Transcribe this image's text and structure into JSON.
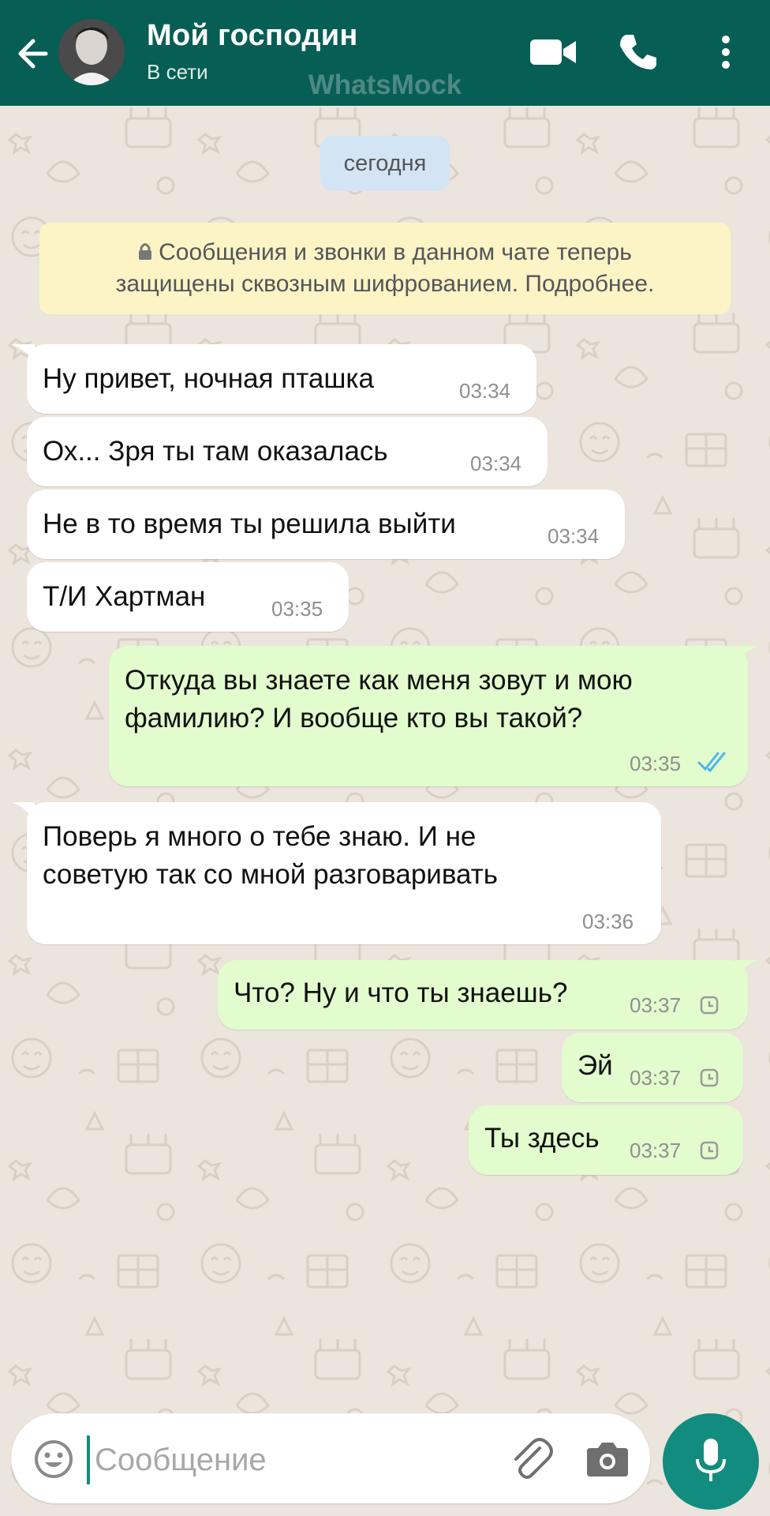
{
  "header": {
    "contact_name": "Мой господин",
    "status": "В сети",
    "watermark": "WhatsMock",
    "icons": [
      "back-arrow-icon",
      "avatar",
      "video-camera-icon",
      "phone-icon",
      "more-vertical-icon"
    ]
  },
  "chat": {
    "date_label": "сегодня",
    "encryption_notice_line1": "Сообщения и звонки в данном чате теперь",
    "encryption_notice_line2": "защищены сквозным шифрованием. Подробнее.",
    "messages": [
      {
        "dir": "in",
        "text": "Ну привет, ночная пташка",
        "time": "03:34"
      },
      {
        "dir": "in",
        "text": "Ох... Зря ты там оказалась",
        "time": "03:34"
      },
      {
        "dir": "in",
        "text": "Не в то время ты решила выйти",
        "time": "03:34"
      },
      {
        "dir": "in",
        "text": "Т/И Хартман",
        "time": "03:35"
      },
      {
        "dir": "out",
        "text_line1": "Откуда вы знаете как меня зовут и мою",
        "text_line2": "фамилию? И вообще кто вы такой?",
        "time": "03:35",
        "status": "read"
      },
      {
        "dir": "in",
        "text_line1": "Поверь я много о тебе знаю. И не",
        "text_line2": "советую так со мной разговаривать",
        "time": "03:36"
      },
      {
        "dir": "out",
        "text": "Что? Ну и что ты знаешь?",
        "time": "03:37",
        "status": "pending"
      },
      {
        "dir": "out",
        "text": "Эй",
        "time": "03:37",
        "status": "pending"
      },
      {
        "dir": "out",
        "text": "Ты здесь",
        "time": "03:37",
        "status": "pending"
      }
    ]
  },
  "input": {
    "placeholder": "Сообщение",
    "value": ""
  },
  "colors": {
    "header": "#075e54",
    "accent": "#128c7e",
    "incoming_bubble": "#ffffff",
    "outgoing_bubble": "#e2fccd",
    "read_ticks": "#4fb6ec",
    "background": "#ece5dd"
  }
}
